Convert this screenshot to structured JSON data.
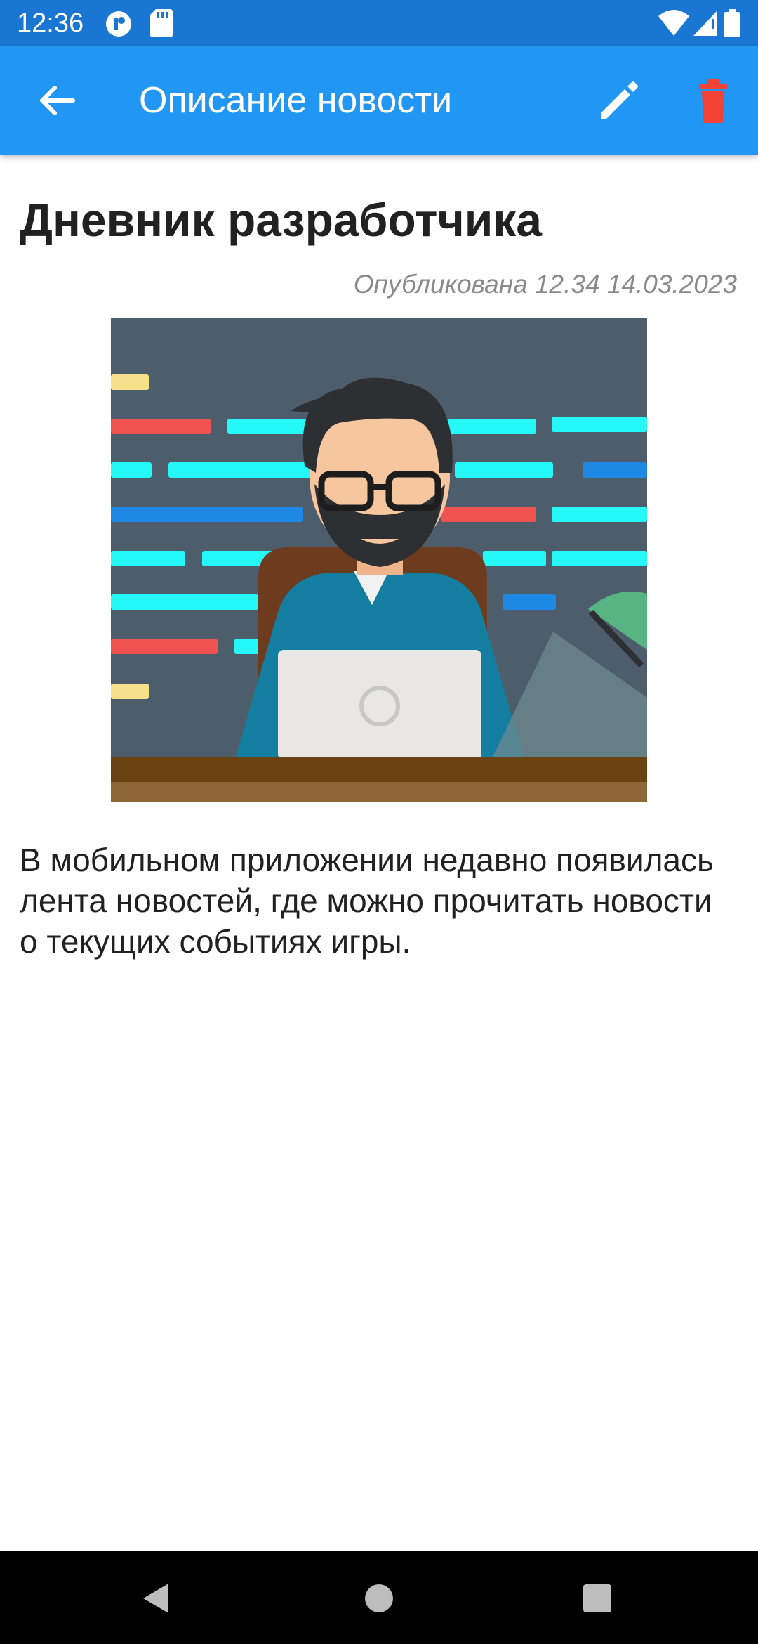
{
  "status_bar": {
    "time": "12:36",
    "icons": [
      "media-icon",
      "sd-card-icon",
      "wifi-icon",
      "signal-icon",
      "battery-icon"
    ]
  },
  "app_bar": {
    "title": "Описание новости",
    "back_icon": "arrow-left-icon",
    "edit_icon": "pencil-icon",
    "delete_icon": "trash-icon",
    "color": "#2196f3",
    "delete_color": "#f44336"
  },
  "news": {
    "title": "Дневник разработчика",
    "published": "Опубликована 12.34 14.03.2023",
    "image": "developer-illustration",
    "body": "В мобильном приложении недавно появилась лента новостей, где можно прочитать новости о текущих событиях игры."
  },
  "nav_bar": {
    "icons": [
      "back-triangle-icon",
      "home-circle-icon",
      "recents-square-icon"
    ]
  }
}
